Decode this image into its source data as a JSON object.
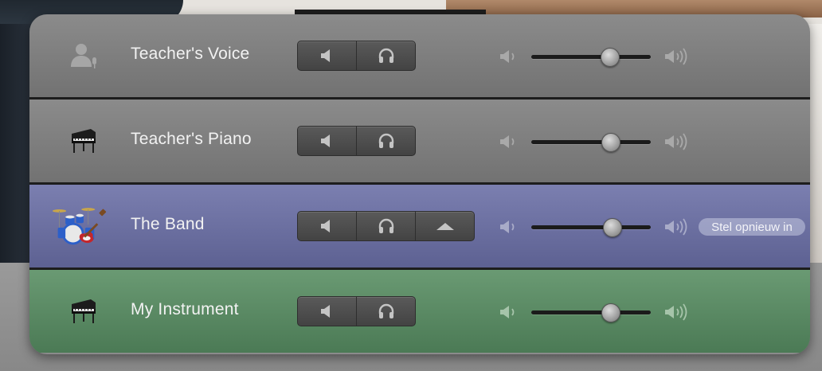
{
  "colors": {
    "track_gray": "#7e7e7e",
    "track_purple": "#6c70a1",
    "track_green": "#5b8a64",
    "separator": "#1d1d1d"
  },
  "tracks": [
    {
      "name": "Teacher's Voice",
      "icon": "person-microphone-icon",
      "buttons": [
        "mute-icon",
        "headphones-icon"
      ],
      "volume": 0.65
    },
    {
      "name": "Teacher's Piano",
      "icon": "grand-piano-icon",
      "buttons": [
        "mute-icon",
        "headphones-icon"
      ],
      "volume": 0.66
    },
    {
      "name": "The Band",
      "icon": "drums-guitar-icon",
      "buttons": [
        "mute-icon",
        "headphones-icon",
        "expand-triangle-icon"
      ],
      "volume": 0.67,
      "reset_label": "Stel opnieuw in"
    },
    {
      "name": "My Instrument",
      "icon": "grand-piano-icon",
      "buttons": [
        "mute-icon",
        "headphones-icon"
      ],
      "volume": 0.66
    }
  ]
}
